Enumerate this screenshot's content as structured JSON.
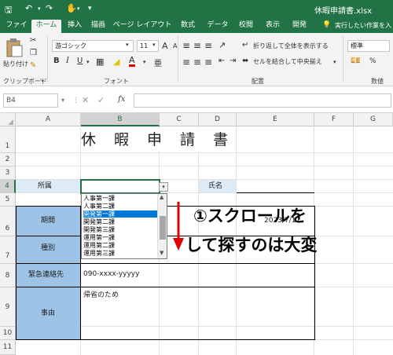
{
  "window": {
    "file_name": "休暇申請書.xlsx"
  },
  "tabs": [
    "ファイル",
    "ホーム",
    "挿入",
    "描画",
    "ページ レイアウト",
    "数式",
    "データ",
    "校閲",
    "表示",
    "開発"
  ],
  "tell_me": "実行したい作業を入力",
  "ribbon": {
    "paste_label": "貼り付け",
    "font_name": "游ゴシック",
    "font_size": "11",
    "wrap_text": "折り返して全体を表示する",
    "merge_center": "セルを結合して中央揃え",
    "number_format": "標準",
    "groups": {
      "clipboard": "クリップボード",
      "font": "フォント",
      "alignment": "配置",
      "number": "数値"
    },
    "bold": "B",
    "italic": "I",
    "underline": "U",
    "font_color_glyph": "A",
    "grow_font": "A",
    "shrink_font": "A"
  },
  "formula_bar": {
    "name_box": "B4",
    "fx": "fx",
    "value": ""
  },
  "columns": [
    "A",
    "B",
    "C",
    "D",
    "E",
    "F",
    "G"
  ],
  "rows": [
    "1",
    "2",
    "3",
    "4",
    "5",
    "6",
    "7",
    "8",
    "9",
    "10",
    "11"
  ],
  "sheet": {
    "title": "休　暇　申　請　書",
    "dept_label": "所属",
    "name_label": "氏名",
    "period_label": "期間",
    "type_label": "種別",
    "contact_label": "緊急連絡先",
    "contact_value": "090-xxxx-yyyyy",
    "reason_label": "事由",
    "reason_value": "帰省のため",
    "partial_date": "2023/7/17"
  },
  "dropdown": {
    "items": [
      "人事第一課",
      "人事第二課",
      "開発第一課",
      "開発第二課",
      "開発第三課",
      "運用第一課",
      "運用第二課",
      "運用第三課"
    ],
    "selected_index": 2
  },
  "annotation": {
    "line1": "①スクロールを",
    "line2": "して探すのは大変"
  },
  "colors": {
    "excel_green": "#217346",
    "header_blue": "#9dc3e6",
    "label_blue": "#ddebf7",
    "arrow_red": "#e00000",
    "selection": "#0078d7"
  }
}
